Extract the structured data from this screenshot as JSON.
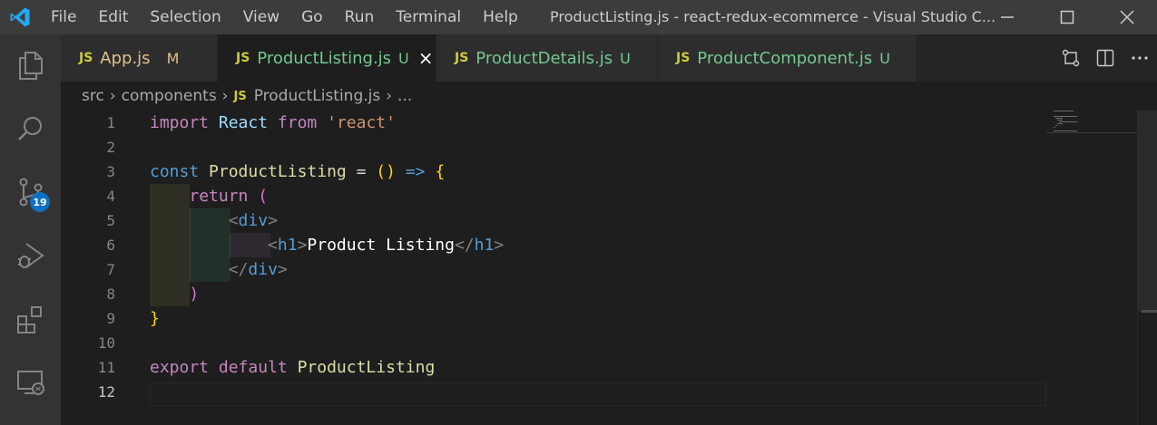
{
  "menu": [
    "File",
    "Edit",
    "Selection",
    "View",
    "Go",
    "Run",
    "Terminal",
    "Help"
  ],
  "window_title": "ProductListing.js - react-redux-ecommerce - Visual Studio C...",
  "activity": {
    "source_control_badge": "19"
  },
  "tabs": [
    {
      "badge": "JS",
      "name": "App.js",
      "status": "M",
      "name_color": "#e2c08d",
      "status_color": "#e2c08d"
    },
    {
      "badge": "JS",
      "name": "ProductListing.js",
      "status": "U",
      "name_color": "#73c991",
      "status_color": "#73c991"
    },
    {
      "badge": "JS",
      "name": "ProductDetails.js",
      "status": "U",
      "name_color": "#73c991",
      "status_color": "#73c991"
    },
    {
      "badge": "JS",
      "name": "ProductComponent.js",
      "status": "U",
      "name_color": "#73c991",
      "status_color": "#73c991"
    }
  ],
  "active_tab_close": "×",
  "breadcrumb": {
    "parts": [
      "src",
      "components",
      "ProductListing.js",
      "..."
    ],
    "sep": "›",
    "js_badge": "JS"
  },
  "line_numbers": [
    "1",
    "2",
    "3",
    "4",
    "5",
    "6",
    "7",
    "8",
    "9",
    "10",
    "11",
    "12"
  ],
  "current_line": 12,
  "code": {
    "l1": {
      "import": "import",
      "react": "React",
      "from": "from",
      "str": "'react'"
    },
    "l3": {
      "const": "const",
      "name": "ProductListing",
      "eq": "=",
      "paren": "()",
      "arrow": "=>",
      "brace": "{"
    },
    "l4": {
      "return": "return",
      "paren": "("
    },
    "l5": {
      "open": "<",
      "tag": "div",
      "close": ">"
    },
    "l6": {
      "open": "<",
      "tag": "h1",
      "close": ">",
      "text": "Product Listing",
      "end_open": "</",
      "end_tag": "h1",
      "end_close": ">"
    },
    "l7": {
      "open": "</",
      "tag": "div",
      "close": ">"
    },
    "l8": {
      "paren": ")"
    },
    "l9": {
      "brace": "}"
    },
    "l11": {
      "export": "export",
      "default": "default",
      "name": "ProductListing"
    }
  },
  "colors": {
    "title_bar": "#3c3c3c",
    "activity_bar": "#333333",
    "editor_bg": "#1e1e1e",
    "badge": "#0e70c0",
    "js_badge": "#cbcb41"
  }
}
